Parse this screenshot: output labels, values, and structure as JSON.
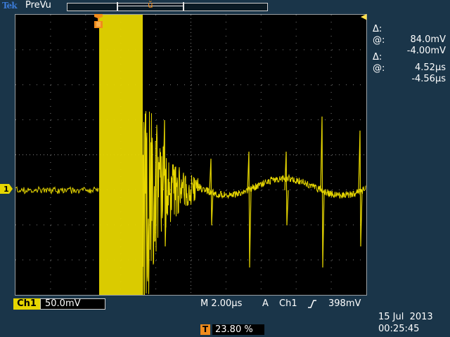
{
  "header": {
    "logo_text": "Tek",
    "acquisition_mode": "PreVu",
    "trigger_position_glyph": "ŭ"
  },
  "cursors": {
    "voltage_delta_symbol": "Δ:",
    "voltage_delta": "84.0mV",
    "voltage_at_symbol": "@:",
    "voltage_at": "-4.00mV",
    "time_delta_symbol": "Δ:",
    "time_delta": "4.52µs",
    "time_at_symbol": "@:",
    "time_at": "-4.56µs"
  },
  "channel": {
    "name": "Ch1",
    "scale": "50.0mV",
    "marker_label": "1",
    "color": "#e6d600"
  },
  "timebase": {
    "label": "M 2.00µs"
  },
  "trigger": {
    "mode": "A",
    "source": "Ch1",
    "level": "398mV",
    "slope": "rising",
    "position_badge": "T",
    "position_percent": "23.80 %",
    "marker_color": "#f08c1c"
  },
  "clock": {
    "date": "15 Jul  2013",
    "time": "00:25:45"
  },
  "icons": {
    "trigger_level": "arrow-left-icon",
    "ground": "channel-marker-icon"
  }
}
